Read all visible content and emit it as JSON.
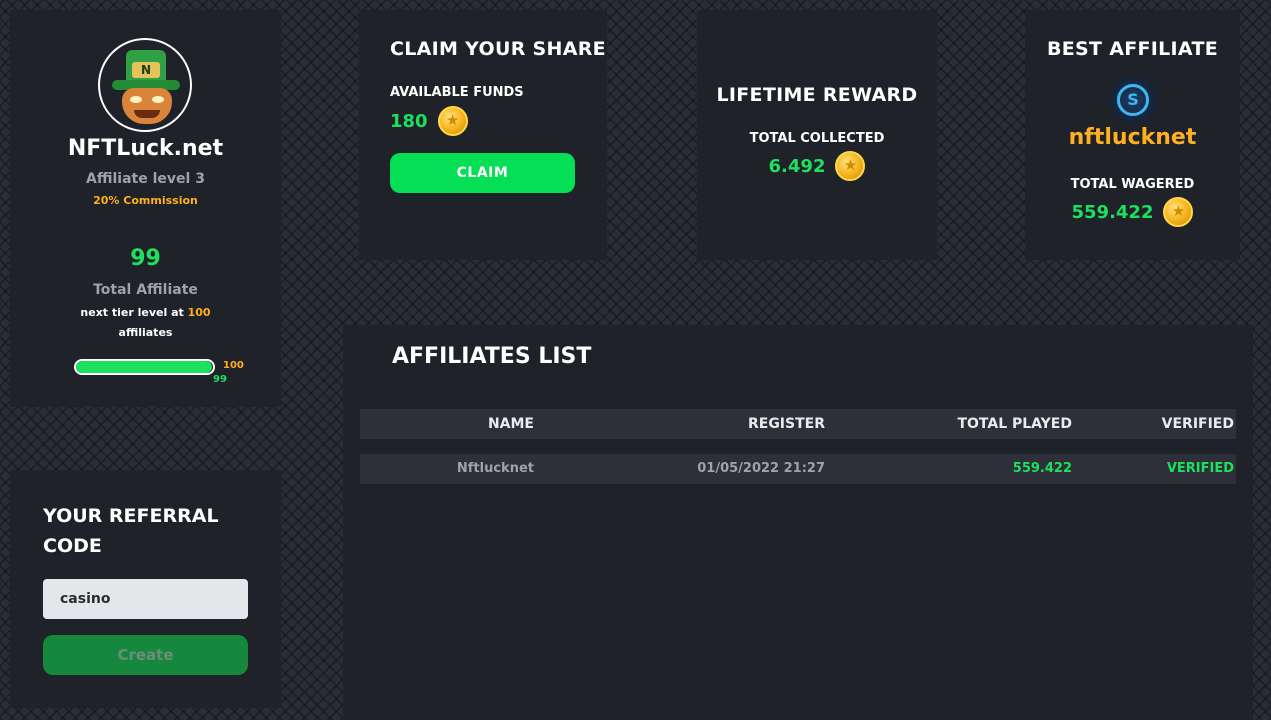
{
  "profile": {
    "avatar_letter": "N",
    "name": "NFTLuck.net",
    "affiliate_level": "Affiliate level 3",
    "commission": "20% Commission",
    "affiliate_count": "99",
    "total_affiliate_label": "Total Affiliate",
    "next_tier_prefix": "next tier level at",
    "next_tier_value": "100",
    "next_tier_suffix": "affiliates",
    "progress_current": 99,
    "progress_max": 100,
    "progress_max_label": "100",
    "progress_current_label": "99"
  },
  "referral": {
    "title": "YOUR REFERRAL CODE",
    "input_value": "casino",
    "create_label": "Create"
  },
  "claim": {
    "title": "CLAIM YOUR SHARE",
    "available_label": "AVAILABLE FUNDS",
    "available_value": "180",
    "claim_label": "CLAIM"
  },
  "lifetime": {
    "title": "LIFETIME REWARD",
    "collected_label": "TOTAL COLLECTED",
    "collected_value": "6.492"
  },
  "best": {
    "title": "BEST AFFILIATE",
    "icon": "s-coin-icon",
    "name": "nftlucknet",
    "wagered_label": "TOTAL WAGERED",
    "wagered_value": "559.422"
  },
  "affiliates_list": {
    "title": "AFFILIATES LIST",
    "columns": [
      "NAME",
      "REGISTER",
      "TOTAL PLAYED",
      "VERIFIED"
    ],
    "rows": [
      {
        "name": "Nftlucknet",
        "register": "01/05/2022 21:27",
        "total_played": "559.422",
        "verified": "VERIFIED"
      }
    ]
  },
  "colors": {
    "accent_green": "#1ee05f",
    "button_green": "#05df56",
    "gold": "#ffb020",
    "panel_bg": "#1f2228"
  }
}
